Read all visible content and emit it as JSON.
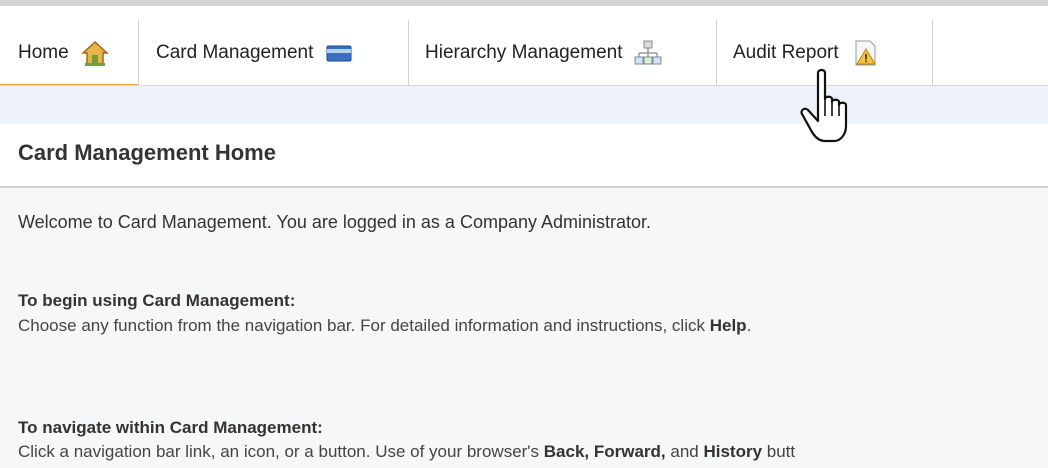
{
  "nav": {
    "tabs": [
      {
        "label": "Home",
        "icon": "home-icon",
        "active": true
      },
      {
        "label": "Card Management",
        "icon": "card-icon"
      },
      {
        "label": "Hierarchy Management",
        "icon": "hierarchy-icon"
      },
      {
        "label": "Audit Report",
        "icon": "warning-icon"
      }
    ]
  },
  "colors": {
    "active_underline": "#f0a030",
    "subbar": "#eef3fb"
  },
  "page": {
    "title": "Card Management Home",
    "welcome": "Welcome to Card Management. You are logged in as a Company Administrator.",
    "begin_heading": "To begin using Card Management:",
    "begin_text_prefix": "Choose any function from the navigation bar. For detailed information and instructions, click ",
    "begin_text_help": "Help",
    "begin_text_suffix": ".",
    "nav_heading": "To navigate within Card Management:",
    "nav_text_prefix": "Click a navigation bar link, an icon, or a button. Use of your browser's ",
    "nav_text_back_forward": "Back, Forward,",
    "nav_text_and": " and ",
    "nav_text_history": "History",
    "nav_text_suffix": " butt"
  }
}
